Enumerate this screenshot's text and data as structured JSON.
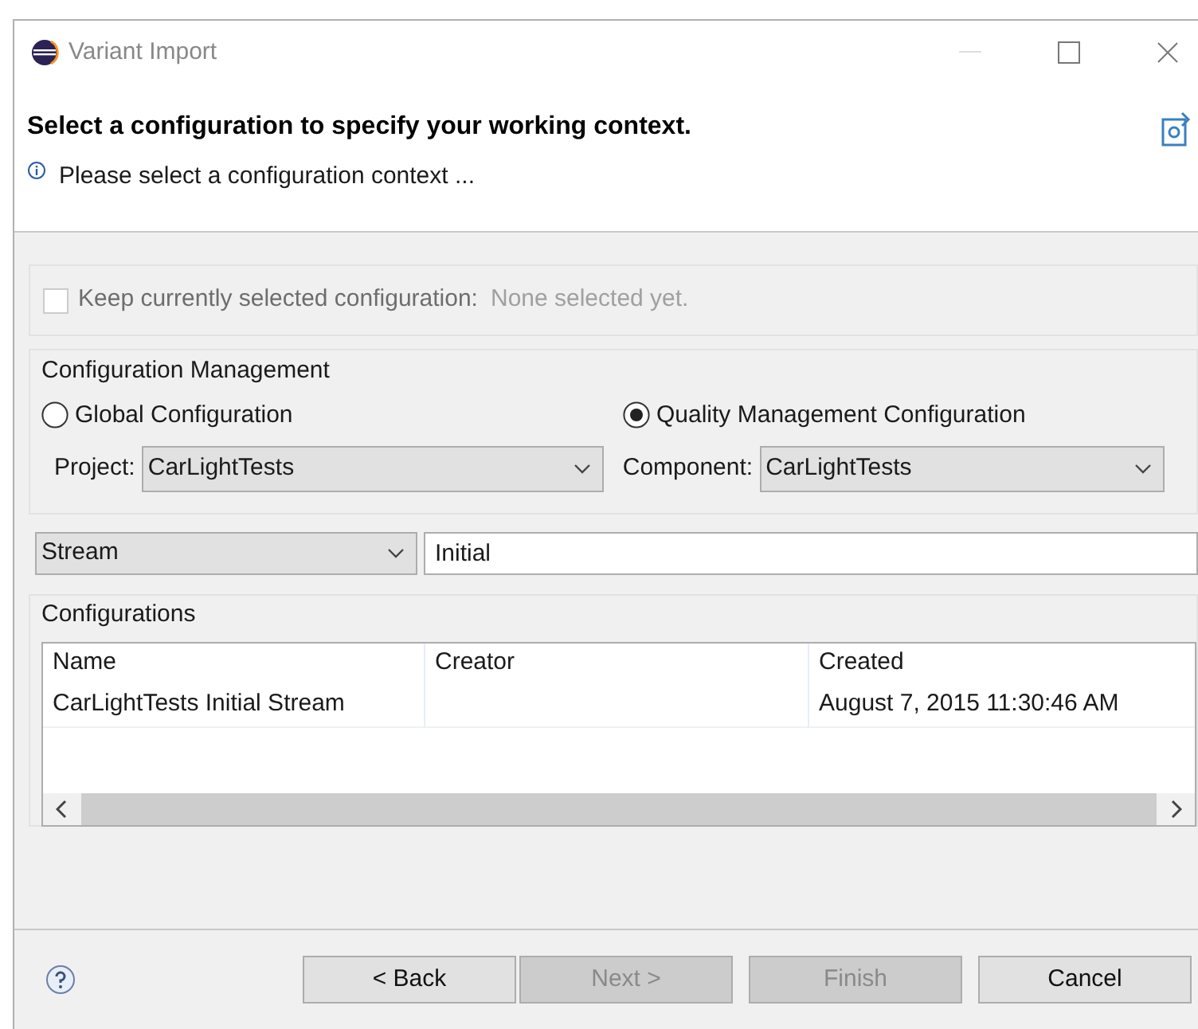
{
  "window": {
    "title": "Variant Import"
  },
  "header": {
    "title": "Select a configuration to specify your working context.",
    "message": "Please select a configuration context ..."
  },
  "keep": {
    "label": "Keep currently selected configuration:",
    "value": "None selected yet.",
    "checked": false,
    "disabled": true
  },
  "configuration_management": {
    "title": "Configuration Management",
    "options": [
      {
        "label": "Global Configuration",
        "selected": false
      },
      {
        "label": "Quality Management Configuration",
        "selected": true
      }
    ],
    "project": {
      "label": "Project:",
      "value": "CarLightTests"
    },
    "component": {
      "label": "Component:",
      "value": "CarLightTests"
    }
  },
  "filter": {
    "type": "Stream",
    "text": "Initial"
  },
  "configurations": {
    "title": "Configurations",
    "columns": [
      "Name",
      "Creator",
      "Created"
    ],
    "rows": [
      [
        "CarLightTests Initial Stream",
        "",
        "August 7, 2015 11:30:46 AM"
      ]
    ]
  },
  "buttons": [
    {
      "label": "< Back",
      "disabled": false
    },
    {
      "label": "Next >",
      "disabled": true
    },
    {
      "label": "Finish",
      "disabled": true
    },
    {
      "label": "Cancel",
      "disabled": false
    }
  ]
}
